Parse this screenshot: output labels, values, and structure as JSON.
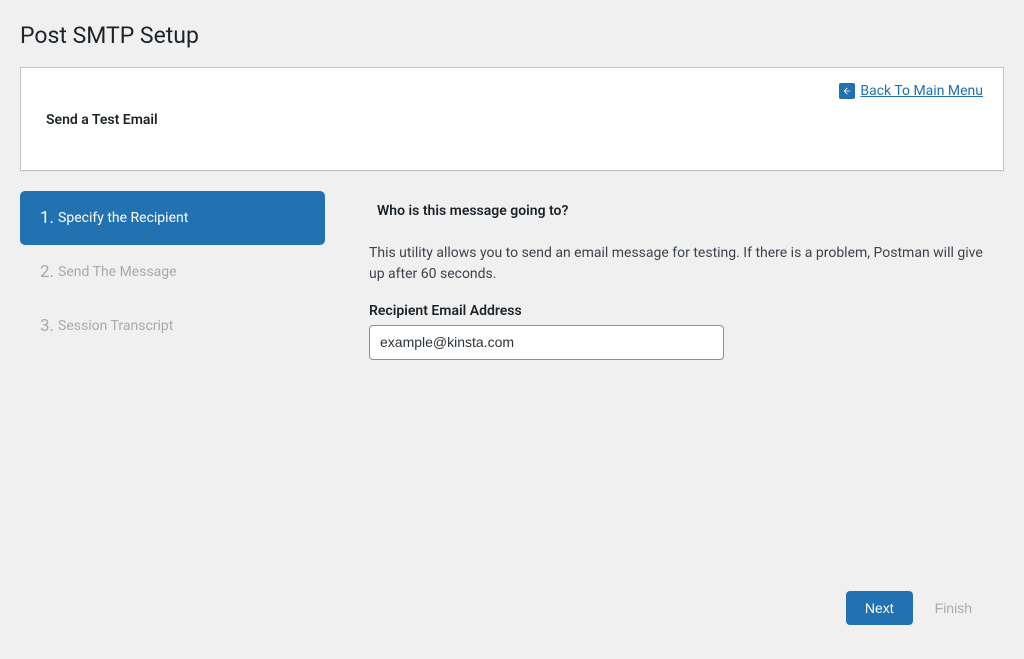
{
  "page": {
    "title": "Post SMTP Setup"
  },
  "header": {
    "card_title": "Send a Test Email",
    "back_link": "Back To Main Menu"
  },
  "wizard": {
    "steps": [
      {
        "num": "1.",
        "label": "Specify the Recipient"
      },
      {
        "num": "2.",
        "label": "Send The Message"
      },
      {
        "num": "3.",
        "label": "Session Transcript"
      }
    ]
  },
  "content": {
    "heading": "Who is this message going to?",
    "description": "This utility allows you to send an email message for testing. If there is a problem, Postman will give up after 60 seconds.",
    "field_label": "Recipient Email Address",
    "field_value": "example@kinsta.com"
  },
  "buttons": {
    "next": "Next",
    "finish": "Finish"
  }
}
